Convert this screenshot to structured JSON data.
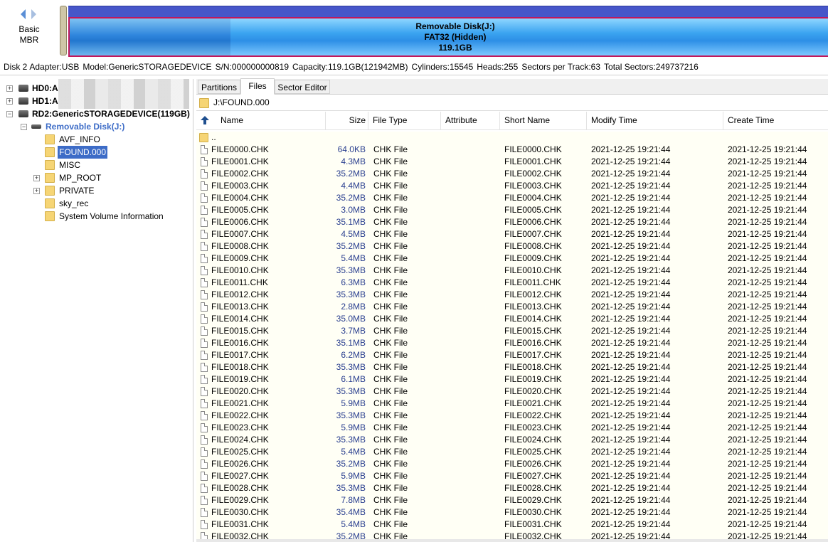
{
  "disk_label": {
    "line1": "Basic",
    "line2": "MBR"
  },
  "partition": {
    "name": "Removable Disk(J:)",
    "fs": "FAT32 (Hidden)",
    "size": "119.1GB"
  },
  "infoline": {
    "disk": "Disk 2",
    "adapter": "Adapter:USB",
    "model": "Model:GenericSTORAGEDEVICE",
    "serial": "S/N:000000000819",
    "capacity": "Capacity:119.1GB(121942MB)",
    "cylinders": "Cylinders:15545",
    "heads": "Heads:255",
    "sectors_per_track": "Sectors per Track:63",
    "total_sectors": "Total Sectors:249737216"
  },
  "tree": {
    "hd0": "HD0:A",
    "hd1": "HD1:A",
    "rd2": "RD2:GenericSTORAGEDEVICE(119GB)",
    "volume": "Removable Disk(J:)",
    "folders": [
      "AVF_INFO",
      "FOUND.000",
      "MISC",
      "MP_ROOT",
      "PRIVATE",
      "sky_rec",
      "System Volume Information"
    ],
    "selected": "FOUND.000"
  },
  "tabs": [
    "Partitions",
    "Files",
    "Sector Editor"
  ],
  "active_tab": "Files",
  "path": "J:\\FOUND.000",
  "columns": [
    "Name",
    "Size",
    "File Type",
    "Attribute",
    "Short Name",
    "Modify Time",
    "Create Time"
  ],
  "parent_entry": "..",
  "files": [
    {
      "name": "FILE0000.CHK",
      "size": "64.0KB",
      "type": "CHK File",
      "short": "FILE0000.CHK",
      "mtime": "2021-12-25 19:21:44",
      "ctime": "2021-12-25 19:21:44"
    },
    {
      "name": "FILE0001.CHK",
      "size": "4.3MB",
      "type": "CHK File",
      "short": "FILE0001.CHK",
      "mtime": "2021-12-25 19:21:44",
      "ctime": "2021-12-25 19:21:44"
    },
    {
      "name": "FILE0002.CHK",
      "size": "35.2MB",
      "type": "CHK File",
      "short": "FILE0002.CHK",
      "mtime": "2021-12-25 19:21:44",
      "ctime": "2021-12-25 19:21:44"
    },
    {
      "name": "FILE0003.CHK",
      "size": "4.4MB",
      "type": "CHK File",
      "short": "FILE0003.CHK",
      "mtime": "2021-12-25 19:21:44",
      "ctime": "2021-12-25 19:21:44"
    },
    {
      "name": "FILE0004.CHK",
      "size": "35.2MB",
      "type": "CHK File",
      "short": "FILE0004.CHK",
      "mtime": "2021-12-25 19:21:44",
      "ctime": "2021-12-25 19:21:44"
    },
    {
      "name": "FILE0005.CHK",
      "size": "3.0MB",
      "type": "CHK File",
      "short": "FILE0005.CHK",
      "mtime": "2021-12-25 19:21:44",
      "ctime": "2021-12-25 19:21:44"
    },
    {
      "name": "FILE0006.CHK",
      "size": "35.1MB",
      "type": "CHK File",
      "short": "FILE0006.CHK",
      "mtime": "2021-12-25 19:21:44",
      "ctime": "2021-12-25 19:21:44"
    },
    {
      "name": "FILE0007.CHK",
      "size": "4.5MB",
      "type": "CHK File",
      "short": "FILE0007.CHK",
      "mtime": "2021-12-25 19:21:44",
      "ctime": "2021-12-25 19:21:44"
    },
    {
      "name": "FILE0008.CHK",
      "size": "35.2MB",
      "type": "CHK File",
      "short": "FILE0008.CHK",
      "mtime": "2021-12-25 19:21:44",
      "ctime": "2021-12-25 19:21:44"
    },
    {
      "name": "FILE0009.CHK",
      "size": "5.4MB",
      "type": "CHK File",
      "short": "FILE0009.CHK",
      "mtime": "2021-12-25 19:21:44",
      "ctime": "2021-12-25 19:21:44"
    },
    {
      "name": "FILE0010.CHK",
      "size": "35.3MB",
      "type": "CHK File",
      "short": "FILE0010.CHK",
      "mtime": "2021-12-25 19:21:44",
      "ctime": "2021-12-25 19:21:44"
    },
    {
      "name": "FILE0011.CHK",
      "size": "6.3MB",
      "type": "CHK File",
      "short": "FILE0011.CHK",
      "mtime": "2021-12-25 19:21:44",
      "ctime": "2021-12-25 19:21:44"
    },
    {
      "name": "FILE0012.CHK",
      "size": "35.3MB",
      "type": "CHK File",
      "short": "FILE0012.CHK",
      "mtime": "2021-12-25 19:21:44",
      "ctime": "2021-12-25 19:21:44"
    },
    {
      "name": "FILE0013.CHK",
      "size": "2.8MB",
      "type": "CHK File",
      "short": "FILE0013.CHK",
      "mtime": "2021-12-25 19:21:44",
      "ctime": "2021-12-25 19:21:44"
    },
    {
      "name": "FILE0014.CHK",
      "size": "35.0MB",
      "type": "CHK File",
      "short": "FILE0014.CHK",
      "mtime": "2021-12-25 19:21:44",
      "ctime": "2021-12-25 19:21:44"
    },
    {
      "name": "FILE0015.CHK",
      "size": "3.7MB",
      "type": "CHK File",
      "short": "FILE0015.CHK",
      "mtime": "2021-12-25 19:21:44",
      "ctime": "2021-12-25 19:21:44"
    },
    {
      "name": "FILE0016.CHK",
      "size": "35.1MB",
      "type": "CHK File",
      "short": "FILE0016.CHK",
      "mtime": "2021-12-25 19:21:44",
      "ctime": "2021-12-25 19:21:44"
    },
    {
      "name": "FILE0017.CHK",
      "size": "6.2MB",
      "type": "CHK File",
      "short": "FILE0017.CHK",
      "mtime": "2021-12-25 19:21:44",
      "ctime": "2021-12-25 19:21:44"
    },
    {
      "name": "FILE0018.CHK",
      "size": "35.3MB",
      "type": "CHK File",
      "short": "FILE0018.CHK",
      "mtime": "2021-12-25 19:21:44",
      "ctime": "2021-12-25 19:21:44"
    },
    {
      "name": "FILE0019.CHK",
      "size": "6.1MB",
      "type": "CHK File",
      "short": "FILE0019.CHK",
      "mtime": "2021-12-25 19:21:44",
      "ctime": "2021-12-25 19:21:44"
    },
    {
      "name": "FILE0020.CHK",
      "size": "35.3MB",
      "type": "CHK File",
      "short": "FILE0020.CHK",
      "mtime": "2021-12-25 19:21:44",
      "ctime": "2021-12-25 19:21:44"
    },
    {
      "name": "FILE0021.CHK",
      "size": "5.9MB",
      "type": "CHK File",
      "short": "FILE0021.CHK",
      "mtime": "2021-12-25 19:21:44",
      "ctime": "2021-12-25 19:21:44"
    },
    {
      "name": "FILE0022.CHK",
      "size": "35.3MB",
      "type": "CHK File",
      "short": "FILE0022.CHK",
      "mtime": "2021-12-25 19:21:44",
      "ctime": "2021-12-25 19:21:44"
    },
    {
      "name": "FILE0023.CHK",
      "size": "5.9MB",
      "type": "CHK File",
      "short": "FILE0023.CHK",
      "mtime": "2021-12-25 19:21:44",
      "ctime": "2021-12-25 19:21:44"
    },
    {
      "name": "FILE0024.CHK",
      "size": "35.3MB",
      "type": "CHK File",
      "short": "FILE0024.CHK",
      "mtime": "2021-12-25 19:21:44",
      "ctime": "2021-12-25 19:21:44"
    },
    {
      "name": "FILE0025.CHK",
      "size": "5.4MB",
      "type": "CHK File",
      "short": "FILE0025.CHK",
      "mtime": "2021-12-25 19:21:44",
      "ctime": "2021-12-25 19:21:44"
    },
    {
      "name": "FILE0026.CHK",
      "size": "35.2MB",
      "type": "CHK File",
      "short": "FILE0026.CHK",
      "mtime": "2021-12-25 19:21:44",
      "ctime": "2021-12-25 19:21:44"
    },
    {
      "name": "FILE0027.CHK",
      "size": "5.9MB",
      "type": "CHK File",
      "short": "FILE0027.CHK",
      "mtime": "2021-12-25 19:21:44",
      "ctime": "2021-12-25 19:21:44"
    },
    {
      "name": "FILE0028.CHK",
      "size": "35.3MB",
      "type": "CHK File",
      "short": "FILE0028.CHK",
      "mtime": "2021-12-25 19:21:44",
      "ctime": "2021-12-25 19:21:44"
    },
    {
      "name": "FILE0029.CHK",
      "size": "7.8MB",
      "type": "CHK File",
      "short": "FILE0029.CHK",
      "mtime": "2021-12-25 19:21:44",
      "ctime": "2021-12-25 19:21:44"
    },
    {
      "name": "FILE0030.CHK",
      "size": "35.4MB",
      "type": "CHK File",
      "short": "FILE0030.CHK",
      "mtime": "2021-12-25 19:21:44",
      "ctime": "2021-12-25 19:21:44"
    },
    {
      "name": "FILE0031.CHK",
      "size": "5.4MB",
      "type": "CHK File",
      "short": "FILE0031.CHK",
      "mtime": "2021-12-25 19:21:44",
      "ctime": "2021-12-25 19:21:44"
    },
    {
      "name": "FILE0032.CHK",
      "size": "35.2MB",
      "type": "CHK File",
      "short": "FILE0032.CHK",
      "mtime": "2021-12-25 19:21:44",
      "ctime": "2021-12-25 19:21:44"
    }
  ],
  "colors": {
    "selection": "#3d6cc7",
    "size_text": "#2a3f8f",
    "row_bg": "#fffff5",
    "partition_border": "#c2185b",
    "volume_label": "#3d6cc7"
  }
}
